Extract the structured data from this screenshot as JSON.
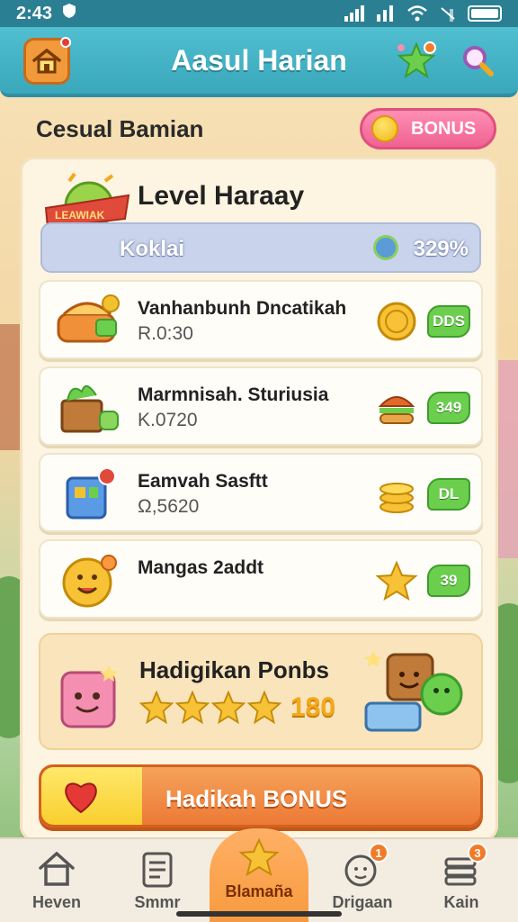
{
  "status_bar": {
    "time": "2:43"
  },
  "header": {
    "title": "Aasul Harian"
  },
  "subheader": {
    "title": "Cesual Bamian",
    "bonus_label": "BONUS"
  },
  "level": {
    "title": "Level Haraay",
    "badge_text": "LEAWIAK",
    "progress_label": "Koklai",
    "progress_pct": "329%"
  },
  "items": [
    {
      "name": "Vanhanbunh Dncatikah",
      "sub": "R.0:30",
      "tag": "DDS",
      "icon": "bread-icon",
      "coin_icon": "coin-icon"
    },
    {
      "name": "Marmnisah. Sturiusia",
      "sub": "K.0720",
      "tag": "349",
      "icon": "crate-icon",
      "coin_icon": "burger-icon"
    },
    {
      "name": "Eamvah Sasftt",
      "sub": "Ω,5620",
      "tag": "DL",
      "icon": "robot-box-icon",
      "coin_icon": "coin-stack-icon"
    },
    {
      "name": "Mangas 2addt",
      "sub": "",
      "tag": "39",
      "icon": "smiley-sun-icon",
      "coin_icon": "star-icon"
    }
  ],
  "bonus_card": {
    "title": "Hadigikan Ponbs",
    "count": "180",
    "stars": 4
  },
  "cta": {
    "label": "Hadikah BONUS"
  },
  "bottom_nav": [
    {
      "label": "Heven",
      "icon": "house-icon",
      "badge": ""
    },
    {
      "label": "Smmr",
      "icon": "clipboard-icon",
      "badge": ""
    },
    {
      "label": "Blamaña",
      "icon": "star-icon",
      "badge": ""
    },
    {
      "label": "Drigaan",
      "icon": "face-icon",
      "badge": "1"
    },
    {
      "label": "Kain",
      "icon": "stack-icon",
      "badge": "3"
    }
  ],
  "colors": {
    "header": "#3aa7bb",
    "accent": "#f79a3e",
    "bonus_pink": "#f06292",
    "tag_green": "#6bcf4d"
  }
}
